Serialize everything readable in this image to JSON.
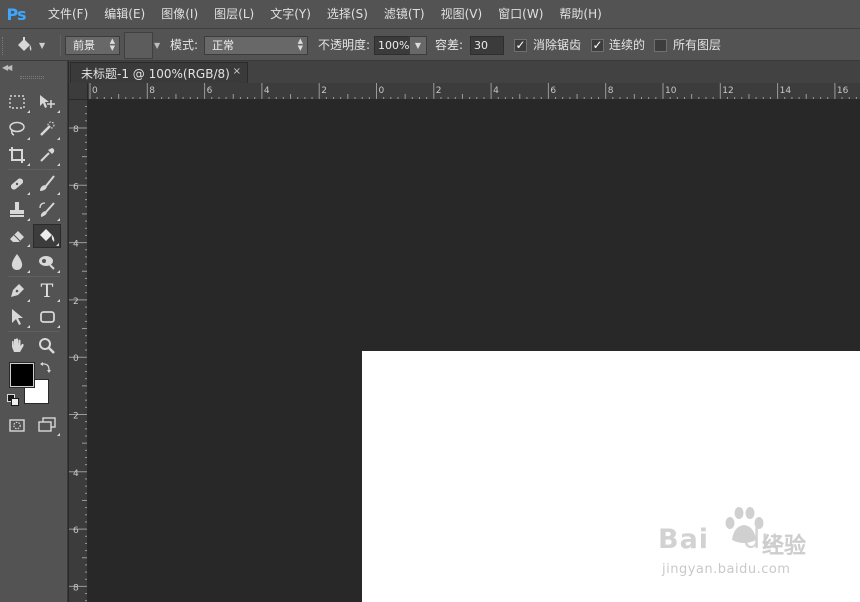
{
  "app": {
    "logo_text": "Ps",
    "menu": [
      "文件(F)",
      "编辑(E)",
      "图像(I)",
      "图层(L)",
      "文字(Y)",
      "选择(S)",
      "滤镜(T)",
      "视图(V)",
      "窗口(W)",
      "帮助(H)"
    ]
  },
  "options_bar": {
    "tool_icon": "paint-bucket-icon",
    "fill_source": "前景",
    "mode_label": "模式:",
    "mode_value": "正常",
    "opacity_label": "不透明度:",
    "opacity_value": "100%",
    "tolerance_label": "容差:",
    "tolerance_value": "30",
    "anti_alias": {
      "label": "消除锯齿",
      "checked": true
    },
    "contiguous": {
      "label": "连续的",
      "checked": true
    },
    "all_layers": {
      "label": "所有图层",
      "checked": false
    },
    "check_mark": "✓"
  },
  "tools": [
    {
      "icon": "rectangular-marquee-icon"
    },
    {
      "icon": "move-icon"
    },
    {
      "icon": "lasso-icon"
    },
    {
      "icon": "quick-selection-icon"
    },
    {
      "icon": "crop-icon"
    },
    {
      "icon": "eyedropper-icon"
    },
    {
      "icon": "spot-healing-brush-icon"
    },
    {
      "icon": "brush-icon"
    },
    {
      "icon": "clone-stamp-icon"
    },
    {
      "icon": "history-brush-icon"
    },
    {
      "icon": "eraser-icon"
    },
    {
      "icon": "paint-bucket-icon",
      "active": true
    },
    {
      "icon": "blur-icon"
    },
    {
      "icon": "dodge-icon"
    },
    {
      "icon": "pen-icon"
    },
    {
      "icon": "type-icon",
      "glyph": "T"
    },
    {
      "icon": "path-selection-icon"
    },
    {
      "icon": "rectangle-shape-icon"
    },
    {
      "icon": "hand-icon"
    },
    {
      "icon": "zoom-icon"
    },
    {
      "icon": "quick-mask-icon"
    },
    {
      "icon": "screen-mode-icon"
    }
  ],
  "colors": {
    "foreground": "#000000",
    "background": "#ffffff",
    "accent": "#3da6ff"
  },
  "document": {
    "tab_title": "未标题-1 @ 100%(RGB/8)",
    "close_glyph": "×",
    "ruler_h_labels": [
      "0",
      "8",
      "6",
      "4",
      "2",
      "0",
      "2",
      "4",
      "6",
      "8",
      "10",
      "12",
      "14",
      "16"
    ],
    "ruler_v_labels": [
      "8",
      "6",
      "4",
      "2",
      "0",
      "2",
      "4",
      "6",
      "8"
    ]
  },
  "watermark": {
    "logo": "Bai",
    "logo_tail": "du",
    "brand": "经验",
    "url": "jingyan.baidu.com"
  }
}
